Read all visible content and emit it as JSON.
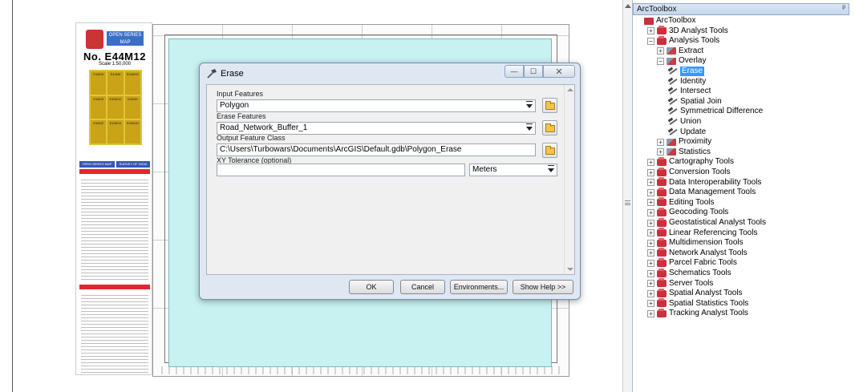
{
  "map": {
    "legend": {
      "header_line": "भारत के सर्वेक्षण महासर्वेक्षक",
      "series_badge": "OPEN SERIES MAP",
      "sheet_number": "No. E44M12",
      "scale": "Scale  1:50,000",
      "index_cells": [
        "E44M4",
        "E44M8",
        "E44M16",
        "E44M3",
        "E44M12",
        "E44N9",
        "E44M2",
        "E44M11",
        "E44N15"
      ],
      "blue_bar_left": "OPEN SERIES MAP",
      "blue_bar_right": "SURVEY OF INDIA"
    },
    "colors": {
      "polygon_fill": "#c8f1f1",
      "legend_red": "#e2262e",
      "legend_blue": "#3657b3",
      "index_yellow": "#e0c43c"
    }
  },
  "dialog": {
    "title": "Erase",
    "window_buttons": {
      "minimize": "—",
      "maximize": "☐",
      "close": "✕"
    },
    "fields": {
      "input_features_label": "Input Features",
      "input_features_value": "Polygon",
      "erase_features_label": "Erase Features",
      "erase_features_value": "Road_Network_Buffer_1",
      "output_label": "Output Feature Class",
      "output_value": "C:\\Users\\Turbowars\\Documents\\ArcGIS\\Default.gdb\\Polygon_Erase",
      "xy_tolerance_label": "XY Tolerance (optional)",
      "xy_tolerance_value": "",
      "units_value": "Meters"
    },
    "buttons": {
      "ok": "OK",
      "cancel": "Cancel",
      "environments": "Environments...",
      "show_help": "Show Help >>"
    }
  },
  "toolbox": {
    "panel_title": "ArcToolbox",
    "pin_glyph": "ᵖ",
    "root_label": "ArcToolbox",
    "items": [
      {
        "label": "3D Analyst Tools",
        "level": 1,
        "expander": "+",
        "icon": "toolbox"
      },
      {
        "label": "Analysis Tools",
        "level": 1,
        "expander": "−",
        "icon": "toolbox"
      },
      {
        "label": "Extract",
        "level": 2,
        "expander": "+",
        "icon": "toolset"
      },
      {
        "label": "Overlay",
        "level": 2,
        "expander": "−",
        "icon": "toolset"
      },
      {
        "label": "Erase",
        "level": 3,
        "expander": "",
        "icon": "tool",
        "selected": true
      },
      {
        "label": "Identity",
        "level": 3,
        "expander": "",
        "icon": "tool"
      },
      {
        "label": "Intersect",
        "level": 3,
        "expander": "",
        "icon": "tool"
      },
      {
        "label": "Spatial Join",
        "level": 3,
        "expander": "",
        "icon": "tool"
      },
      {
        "label": "Symmetrical Difference",
        "level": 3,
        "expander": "",
        "icon": "tool"
      },
      {
        "label": "Union",
        "level": 3,
        "expander": "",
        "icon": "tool"
      },
      {
        "label": "Update",
        "level": 3,
        "expander": "",
        "icon": "tool"
      },
      {
        "label": "Proximity",
        "level": 2,
        "expander": "+",
        "icon": "toolset"
      },
      {
        "label": "Statistics",
        "level": 2,
        "expander": "+",
        "icon": "toolset"
      },
      {
        "label": "Cartography Tools",
        "level": 1,
        "expander": "+",
        "icon": "toolbox"
      },
      {
        "label": "Conversion Tools",
        "level": 1,
        "expander": "+",
        "icon": "toolbox"
      },
      {
        "label": "Data Interoperability Tools",
        "level": 1,
        "expander": "+",
        "icon": "toolbox"
      },
      {
        "label": "Data Management Tools",
        "level": 1,
        "expander": "+",
        "icon": "toolbox"
      },
      {
        "label": "Editing Tools",
        "level": 1,
        "expander": "+",
        "icon": "toolbox"
      },
      {
        "label": "Geocoding Tools",
        "level": 1,
        "expander": "+",
        "icon": "toolbox"
      },
      {
        "label": "Geostatistical Analyst Tools",
        "level": 1,
        "expander": "+",
        "icon": "toolbox"
      },
      {
        "label": "Linear Referencing Tools",
        "level": 1,
        "expander": "+",
        "icon": "toolbox"
      },
      {
        "label": "Multidimension Tools",
        "level": 1,
        "expander": "+",
        "icon": "toolbox"
      },
      {
        "label": "Network Analyst Tools",
        "level": 1,
        "expander": "+",
        "icon": "toolbox"
      },
      {
        "label": "Parcel Fabric Tools",
        "level": 1,
        "expander": "+",
        "icon": "toolbox"
      },
      {
        "label": "Schematics Tools",
        "level": 1,
        "expander": "+",
        "icon": "toolbox"
      },
      {
        "label": "Server Tools",
        "level": 1,
        "expander": "+",
        "icon": "toolbox"
      },
      {
        "label": "Spatial Analyst Tools",
        "level": 1,
        "expander": "+",
        "icon": "toolbox"
      },
      {
        "label": "Spatial Statistics Tools",
        "level": 1,
        "expander": "+",
        "icon": "toolbox"
      },
      {
        "label": "Tracking Analyst Tools",
        "level": 1,
        "expander": "+",
        "icon": "toolbox"
      }
    ]
  }
}
